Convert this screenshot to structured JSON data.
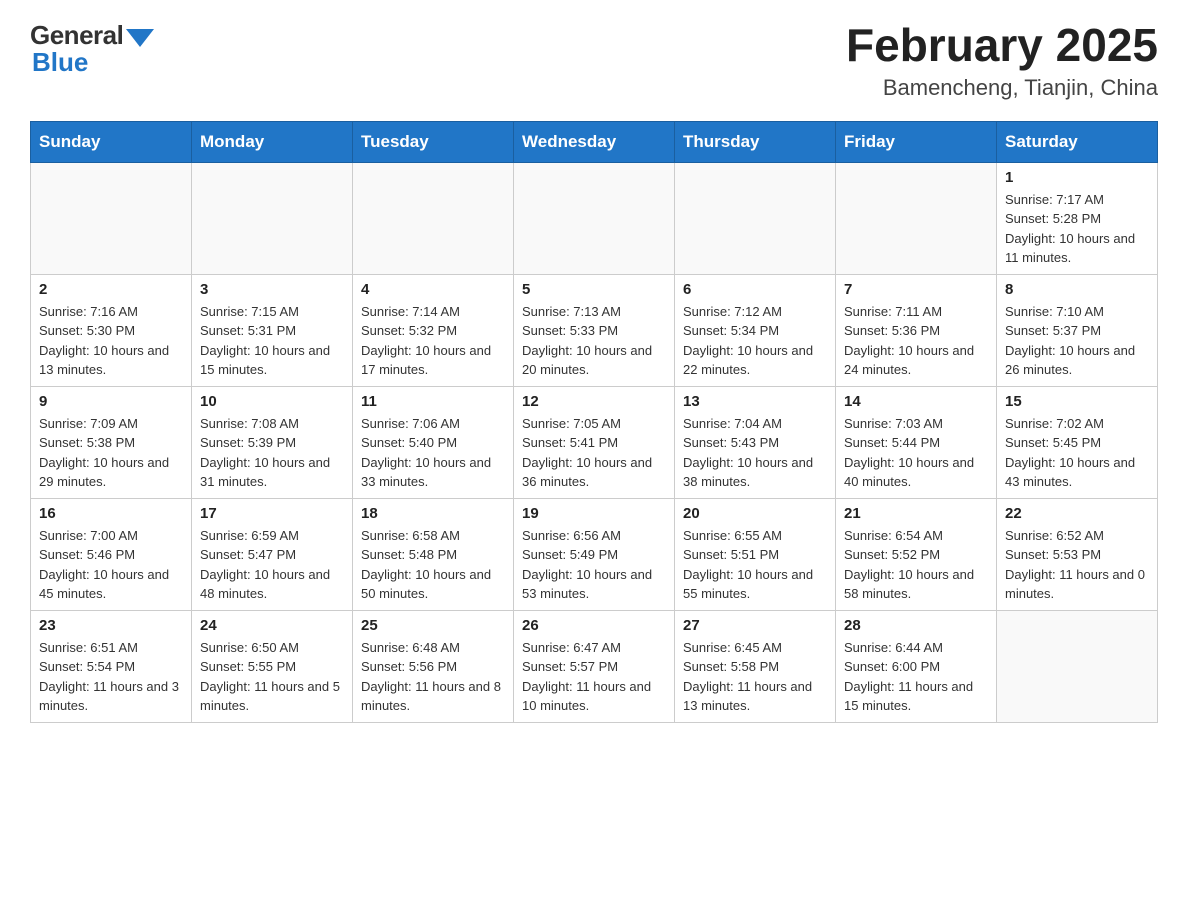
{
  "header": {
    "logo_general": "General",
    "logo_blue": "Blue",
    "title": "February 2025",
    "location": "Bamencheng, Tianjin, China"
  },
  "days_of_week": [
    "Sunday",
    "Monday",
    "Tuesday",
    "Wednesday",
    "Thursday",
    "Friday",
    "Saturday"
  ],
  "weeks": [
    [
      {
        "day": "",
        "info": ""
      },
      {
        "day": "",
        "info": ""
      },
      {
        "day": "",
        "info": ""
      },
      {
        "day": "",
        "info": ""
      },
      {
        "day": "",
        "info": ""
      },
      {
        "day": "",
        "info": ""
      },
      {
        "day": "1",
        "info": "Sunrise: 7:17 AM\nSunset: 5:28 PM\nDaylight: 10 hours and 11 minutes."
      }
    ],
    [
      {
        "day": "2",
        "info": "Sunrise: 7:16 AM\nSunset: 5:30 PM\nDaylight: 10 hours and 13 minutes."
      },
      {
        "day": "3",
        "info": "Sunrise: 7:15 AM\nSunset: 5:31 PM\nDaylight: 10 hours and 15 minutes."
      },
      {
        "day": "4",
        "info": "Sunrise: 7:14 AM\nSunset: 5:32 PM\nDaylight: 10 hours and 17 minutes."
      },
      {
        "day": "5",
        "info": "Sunrise: 7:13 AM\nSunset: 5:33 PM\nDaylight: 10 hours and 20 minutes."
      },
      {
        "day": "6",
        "info": "Sunrise: 7:12 AM\nSunset: 5:34 PM\nDaylight: 10 hours and 22 minutes."
      },
      {
        "day": "7",
        "info": "Sunrise: 7:11 AM\nSunset: 5:36 PM\nDaylight: 10 hours and 24 minutes."
      },
      {
        "day": "8",
        "info": "Sunrise: 7:10 AM\nSunset: 5:37 PM\nDaylight: 10 hours and 26 minutes."
      }
    ],
    [
      {
        "day": "9",
        "info": "Sunrise: 7:09 AM\nSunset: 5:38 PM\nDaylight: 10 hours and 29 minutes."
      },
      {
        "day": "10",
        "info": "Sunrise: 7:08 AM\nSunset: 5:39 PM\nDaylight: 10 hours and 31 minutes."
      },
      {
        "day": "11",
        "info": "Sunrise: 7:06 AM\nSunset: 5:40 PM\nDaylight: 10 hours and 33 minutes."
      },
      {
        "day": "12",
        "info": "Sunrise: 7:05 AM\nSunset: 5:41 PM\nDaylight: 10 hours and 36 minutes."
      },
      {
        "day": "13",
        "info": "Sunrise: 7:04 AM\nSunset: 5:43 PM\nDaylight: 10 hours and 38 minutes."
      },
      {
        "day": "14",
        "info": "Sunrise: 7:03 AM\nSunset: 5:44 PM\nDaylight: 10 hours and 40 minutes."
      },
      {
        "day": "15",
        "info": "Sunrise: 7:02 AM\nSunset: 5:45 PM\nDaylight: 10 hours and 43 minutes."
      }
    ],
    [
      {
        "day": "16",
        "info": "Sunrise: 7:00 AM\nSunset: 5:46 PM\nDaylight: 10 hours and 45 minutes."
      },
      {
        "day": "17",
        "info": "Sunrise: 6:59 AM\nSunset: 5:47 PM\nDaylight: 10 hours and 48 minutes."
      },
      {
        "day": "18",
        "info": "Sunrise: 6:58 AM\nSunset: 5:48 PM\nDaylight: 10 hours and 50 minutes."
      },
      {
        "day": "19",
        "info": "Sunrise: 6:56 AM\nSunset: 5:49 PM\nDaylight: 10 hours and 53 minutes."
      },
      {
        "day": "20",
        "info": "Sunrise: 6:55 AM\nSunset: 5:51 PM\nDaylight: 10 hours and 55 minutes."
      },
      {
        "day": "21",
        "info": "Sunrise: 6:54 AM\nSunset: 5:52 PM\nDaylight: 10 hours and 58 minutes."
      },
      {
        "day": "22",
        "info": "Sunrise: 6:52 AM\nSunset: 5:53 PM\nDaylight: 11 hours and 0 minutes."
      }
    ],
    [
      {
        "day": "23",
        "info": "Sunrise: 6:51 AM\nSunset: 5:54 PM\nDaylight: 11 hours and 3 minutes."
      },
      {
        "day": "24",
        "info": "Sunrise: 6:50 AM\nSunset: 5:55 PM\nDaylight: 11 hours and 5 minutes."
      },
      {
        "day": "25",
        "info": "Sunrise: 6:48 AM\nSunset: 5:56 PM\nDaylight: 11 hours and 8 minutes."
      },
      {
        "day": "26",
        "info": "Sunrise: 6:47 AM\nSunset: 5:57 PM\nDaylight: 11 hours and 10 minutes."
      },
      {
        "day": "27",
        "info": "Sunrise: 6:45 AM\nSunset: 5:58 PM\nDaylight: 11 hours and 13 minutes."
      },
      {
        "day": "28",
        "info": "Sunrise: 6:44 AM\nSunset: 6:00 PM\nDaylight: 11 hours and 15 minutes."
      },
      {
        "day": "",
        "info": ""
      }
    ]
  ]
}
